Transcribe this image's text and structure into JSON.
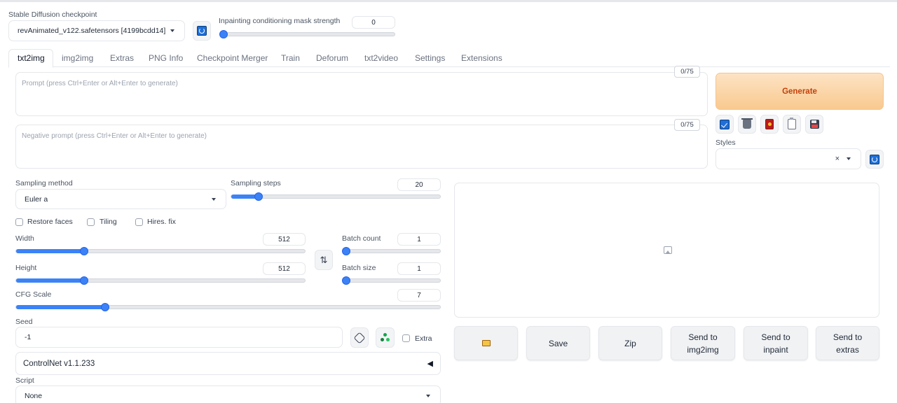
{
  "checkpoint": {
    "label": "Stable Diffusion checkpoint",
    "value": "revAnimated_v122.safetensors [4199bcdd14]"
  },
  "inpaint_mask": {
    "label": "Inpainting conditioning mask strength",
    "value": "0",
    "fraction": 0.0
  },
  "tabs": [
    "txt2img",
    "img2img",
    "Extras",
    "PNG Info",
    "Checkpoint Merger",
    "Train",
    "Deforum",
    "txt2video",
    "Settings",
    "Extensions"
  ],
  "prompt": {
    "placeholder": "Prompt (press Ctrl+Enter or Alt+Enter to generate)",
    "counter": "0/75"
  },
  "negative_prompt": {
    "placeholder": "Negative prompt (press Ctrl+Enter or Alt+Enter to generate)",
    "counter": "0/75"
  },
  "generate": {
    "label": "Generate"
  },
  "styles": {
    "label": "Styles",
    "clear": "×"
  },
  "sampling_method": {
    "label": "Sampling method",
    "value": "Euler a"
  },
  "sampling_steps": {
    "label": "Sampling steps",
    "value": "20",
    "fraction": 0.13
  },
  "checkboxes": {
    "restore_faces": "Restore faces",
    "tiling": "Tiling",
    "hires_fix": "Hires. fix"
  },
  "width": {
    "label": "Width",
    "value": "512",
    "fraction": 0.235
  },
  "height": {
    "label": "Height",
    "value": "512",
    "fraction": 0.235
  },
  "swap": {
    "label": "⇅"
  },
  "batch_count": {
    "label": "Batch count",
    "value": "1",
    "fraction": 0.0
  },
  "batch_size": {
    "label": "Batch size",
    "value": "1",
    "fraction": 0.0
  },
  "cfg_scale": {
    "label": "CFG Scale",
    "value": "7",
    "fraction": 0.21
  },
  "seed": {
    "label": "Seed",
    "value": "-1",
    "extra": "Extra"
  },
  "controlnet": {
    "label": "ControlNet v1.1.233",
    "toggle": "◀"
  },
  "script": {
    "label": "Script",
    "value": "None"
  },
  "output_buttons": {
    "save": "Save",
    "zip": "Zip",
    "send_img2img": [
      "Send to",
      "img2img"
    ],
    "send_inpaint": [
      "Send to",
      "inpaint"
    ],
    "send_extras": [
      "Send to",
      "extras"
    ]
  },
  "colors": {
    "accent": "#3b82f6",
    "generate_text": "#c2410c",
    "generate_bg": "#fbd5a8"
  }
}
